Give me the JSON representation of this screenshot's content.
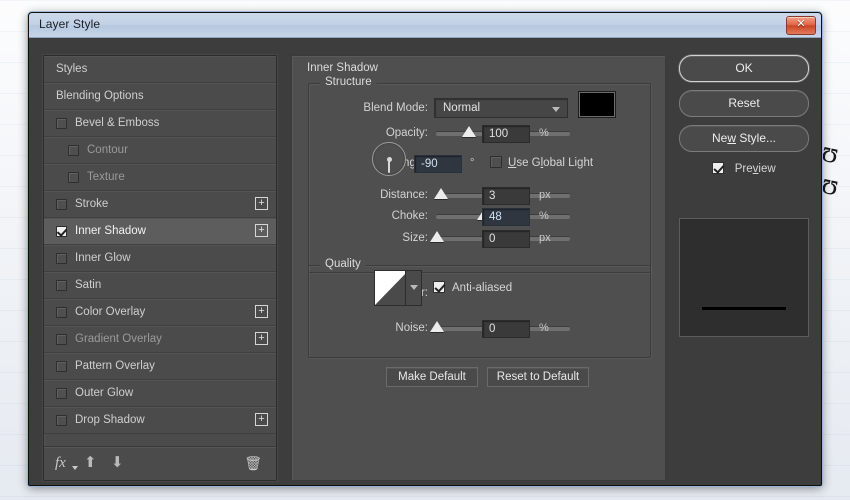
{
  "window": {
    "title": "Layer Style",
    "close_label": "✕"
  },
  "styles_panel": {
    "items": [
      {
        "label": "Styles",
        "type": "header",
        "checked": false,
        "has_plus": false,
        "selected": false,
        "dim": false,
        "indent": false
      },
      {
        "label": "Blending Options",
        "type": "header",
        "checked": false,
        "has_plus": false,
        "selected": false,
        "dim": false,
        "indent": false
      },
      {
        "label": "Bevel & Emboss",
        "type": "checkbox",
        "checked": false,
        "has_plus": false,
        "selected": false,
        "dim": false,
        "indent": false
      },
      {
        "label": "Contour",
        "type": "checkbox",
        "checked": false,
        "has_plus": false,
        "selected": false,
        "dim": true,
        "indent": true
      },
      {
        "label": "Texture",
        "type": "checkbox",
        "checked": false,
        "has_plus": false,
        "selected": false,
        "dim": true,
        "indent": true
      },
      {
        "label": "Stroke",
        "type": "checkbox",
        "checked": false,
        "has_plus": true,
        "selected": false,
        "dim": false,
        "indent": false
      },
      {
        "label": "Inner Shadow",
        "type": "checkbox",
        "checked": true,
        "has_plus": true,
        "selected": true,
        "dim": false,
        "indent": false
      },
      {
        "label": "Inner Glow",
        "type": "checkbox",
        "checked": false,
        "has_plus": false,
        "selected": false,
        "dim": false,
        "indent": false
      },
      {
        "label": "Satin",
        "type": "checkbox",
        "checked": false,
        "has_plus": false,
        "selected": false,
        "dim": false,
        "indent": false
      },
      {
        "label": "Color Overlay",
        "type": "checkbox",
        "checked": false,
        "has_plus": true,
        "selected": false,
        "dim": false,
        "indent": false
      },
      {
        "label": "Gradient Overlay",
        "type": "checkbox",
        "checked": false,
        "has_plus": true,
        "selected": false,
        "dim": true,
        "indent": false
      },
      {
        "label": "Pattern Overlay",
        "type": "checkbox",
        "checked": false,
        "has_plus": false,
        "selected": false,
        "dim": false,
        "indent": false
      },
      {
        "label": "Outer Glow",
        "type": "checkbox",
        "checked": false,
        "has_plus": false,
        "selected": false,
        "dim": false,
        "indent": false
      },
      {
        "label": "Drop Shadow",
        "type": "checkbox",
        "checked": false,
        "has_plus": true,
        "selected": false,
        "dim": false,
        "indent": false
      }
    ],
    "toolbar": {
      "fx_icon": "fx",
      "up_icon": "⬆",
      "down_icon": "⬇",
      "trash_icon": "🗑"
    }
  },
  "effect": {
    "title": "Inner Shadow",
    "structure": {
      "legend": "Structure",
      "blend_mode_label": "Blend Mode:",
      "blend_mode_value": "Normal",
      "shadow_color": "#000000",
      "opacity_label": "Opacity:",
      "opacity_value": "100",
      "opacity_unit": "%",
      "angle_label": "Angle:",
      "angle_value": "-90",
      "angle_unit": "°",
      "use_global_light_label": "Use Global Light",
      "use_global_light_checked": false,
      "distance_label": "Distance:",
      "distance_value": "3",
      "distance_unit": "px",
      "choke_label": "Choke:",
      "choke_value": "48",
      "choke_unit": "%",
      "size_label": "Size:",
      "size_value": "0",
      "size_unit": "px"
    },
    "quality": {
      "legend": "Quality",
      "contour_label": "Contour:",
      "anti_aliased_label": "Anti-aliased",
      "anti_aliased_checked": true,
      "noise_label": "Noise:",
      "noise_value": "0",
      "noise_unit": "%"
    },
    "make_default_label": "Make Default",
    "reset_to_default_label": "Reset to Default"
  },
  "actions": {
    "ok_label": "OK",
    "reset_label": "Reset",
    "new_style_label": "New Style...",
    "preview_label": "Preview",
    "preview_checked": true
  },
  "theme": {
    "dialog_bg": "#3d3d3d",
    "panel_bg": "#4f4f4f",
    "list_bg": "#4b4b4b",
    "selected_row": "#5d5d5d",
    "text": "#d2d2d2",
    "titlebar": "#c2d2e6",
    "close_red": "#cd4526",
    "focus_field": "#2f3640"
  }
}
